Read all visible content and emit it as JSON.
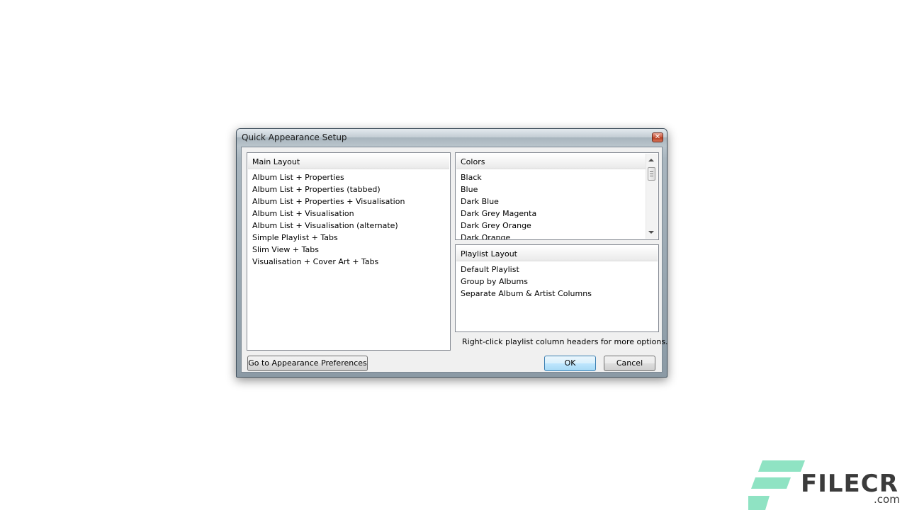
{
  "window": {
    "title": "Quick Appearance Setup"
  },
  "main_layout": {
    "header": "Main Layout",
    "items": [
      "Album List + Properties",
      "Album List + Properties (tabbed)",
      "Album List + Properties + Visualisation",
      "Album List + Visualisation",
      "Album List + Visualisation (alternate)",
      "Simple Playlist + Tabs",
      "Slim View + Tabs",
      "Visualisation + Cover Art + Tabs"
    ]
  },
  "colors": {
    "header": "Colors",
    "items": [
      "Black",
      "Blue",
      "Dark Blue",
      "Dark Grey Magenta",
      "Dark Grey Orange",
      "Dark Orange"
    ]
  },
  "playlist_layout": {
    "header": "Playlist Layout",
    "items": [
      "Default Playlist",
      "Group by Albums",
      "Separate Album & Artist Columns"
    ]
  },
  "hint_text": "Right-click playlist column headers for more options.",
  "buttons": {
    "appearance_prefs": "Go to Appearance Preferences",
    "ok": "OK",
    "cancel": "Cancel"
  },
  "watermark": {
    "name": "FILECR",
    "suffix": ".com"
  },
  "theme": {
    "accent": "#3c7fb1",
    "close": "#c8573d",
    "brand_green": "#8fe3c3"
  }
}
